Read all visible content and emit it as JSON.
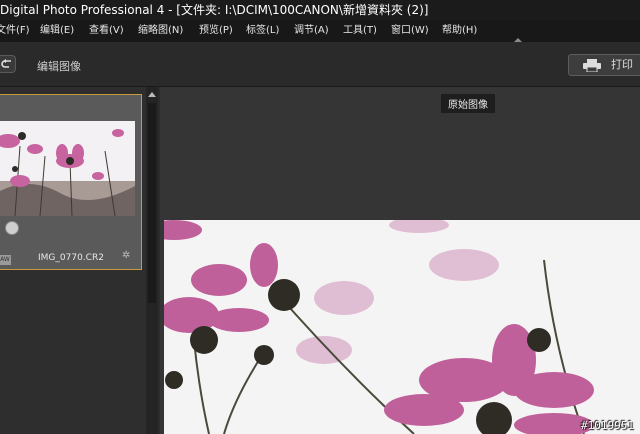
{
  "window": {
    "title": "Digital Photo Professional 4 - [文件夹: I:\\DCIM\\100CANON\\新增資料夾 (2)]"
  },
  "menu": {
    "items": [
      {
        "label": "文件(F)"
      },
      {
        "label": "编辑(E)"
      },
      {
        "label": "查看(V)"
      },
      {
        "label": "缩略图(N)"
      },
      {
        "label": "预览(P)"
      },
      {
        "label": "标签(L)"
      },
      {
        "label": "调节(A)"
      },
      {
        "label": "工具(T)"
      },
      {
        "label": "窗口(W)"
      },
      {
        "label": "帮助(H)"
      }
    ]
  },
  "toolbar": {
    "title": "编辑图像",
    "print_label": "打印"
  },
  "thumbnail": {
    "raw_badge": "RAW",
    "filename": "IMG_0770.CR2"
  },
  "viewer": {
    "label": "原始图像"
  },
  "watermark": "#1019951",
  "colors": {
    "selection_border": "#c79a3c",
    "petal": "#c7649f",
    "background": "#2b2b2b"
  }
}
